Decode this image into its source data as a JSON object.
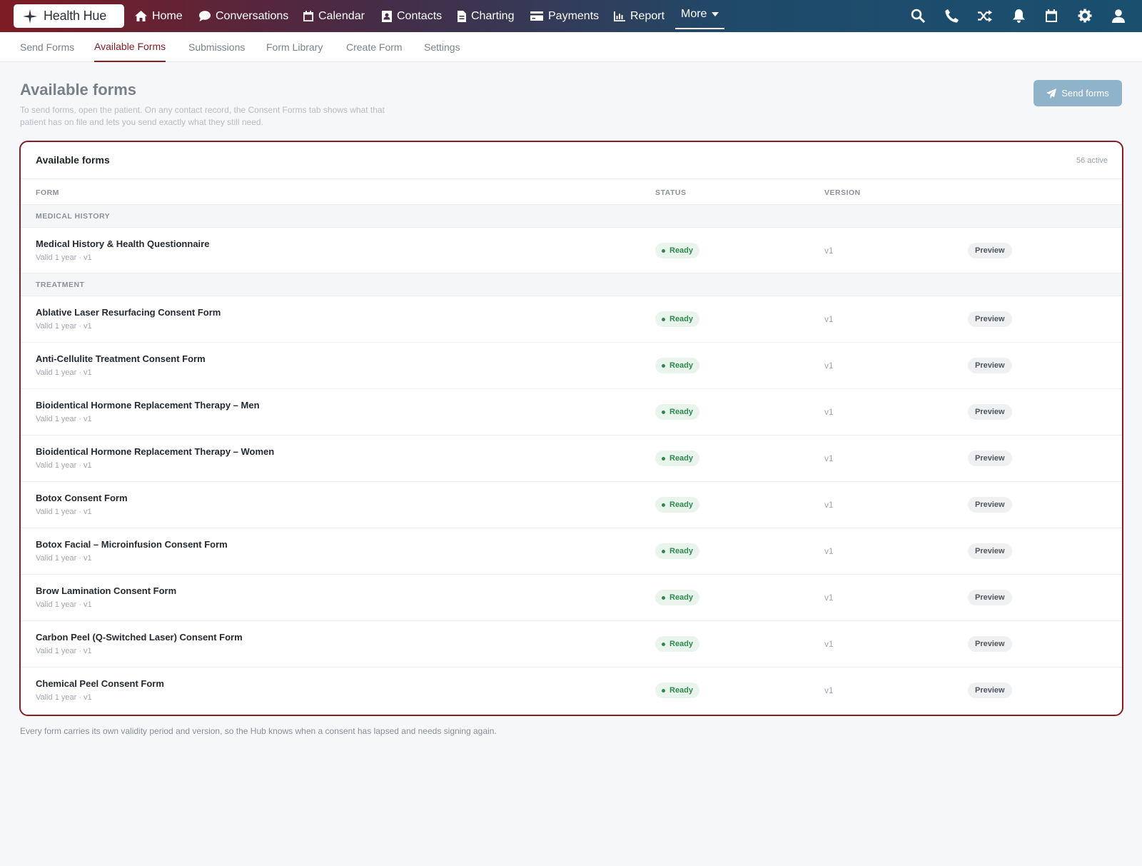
{
  "brand": {
    "name": "Health Hue"
  },
  "nav": {
    "items": [
      {
        "label": "Home",
        "icon": "home-icon"
      },
      {
        "label": "Conversations",
        "icon": "chat-icon"
      },
      {
        "label": "Calendar",
        "icon": "calendar-icon"
      },
      {
        "label": "Contacts",
        "icon": "contacts-icon"
      },
      {
        "label": "Charting",
        "icon": "document-icon"
      },
      {
        "label": "Payments",
        "icon": "credit-card-icon"
      },
      {
        "label": "Report",
        "icon": "chart-icon"
      }
    ],
    "more_label": "More",
    "right_icons": [
      "search-icon",
      "phone-icon",
      "shuffle-icon",
      "bell-icon",
      "calendar-icon",
      "gear-icon",
      "user-icon"
    ]
  },
  "subtabs": [
    "Send Forms",
    "Available Forms",
    "Submissions",
    "Form Library",
    "Create Form",
    "Settings"
  ],
  "active_subtab": "Available Forms",
  "page": {
    "title": "Available forms",
    "description": "To send forms, open the patient. On any contact record, the Consent Forms tab shows what that patient has on file and lets you send exactly what they still need.",
    "send_button": "Send forms"
  },
  "card": {
    "title": "Available forms",
    "count": "56 active",
    "columns": {
      "form": "FORM",
      "status": "STATUS",
      "version": "VERSION"
    }
  },
  "groups": [
    {
      "label": "MEDICAL HISTORY",
      "forms": [
        {
          "name": "Medical History & Health Questionnaire",
          "meta": "Valid 1 year · v1",
          "status": "Ready",
          "version": "v1",
          "action": "Preview"
        }
      ]
    },
    {
      "label": "TREATMENT",
      "forms": [
        {
          "name": "Ablative Laser Resurfacing Consent Form",
          "meta": "Valid 1 year · v1",
          "status": "Ready",
          "version": "v1",
          "action": "Preview"
        },
        {
          "name": "Anti-Cellulite Treatment Consent Form",
          "meta": "Valid 1 year · v1",
          "status": "Ready",
          "version": "v1",
          "action": "Preview"
        },
        {
          "name": "Bioidentical Hormone Replacement Therapy – Men",
          "meta": "Valid 1 year · v1",
          "status": "Ready",
          "version": "v1",
          "action": "Preview"
        },
        {
          "name": "Bioidentical Hormone Replacement Therapy – Women",
          "meta": "Valid 1 year · v1",
          "status": "Ready",
          "version": "v1",
          "action": "Preview"
        },
        {
          "name": "Botox Consent Form",
          "meta": "Valid 1 year · v1",
          "status": "Ready",
          "version": "v1",
          "action": "Preview"
        },
        {
          "name": "Botox Facial – Microinfusion Consent Form",
          "meta": "Valid 1 year · v1",
          "status": "Ready",
          "version": "v1",
          "action": "Preview"
        },
        {
          "name": "Brow Lamination Consent Form",
          "meta": "Valid 1 year · v1",
          "status": "Ready",
          "version": "v1",
          "action": "Preview"
        },
        {
          "name": "Carbon Peel (Q-Switched Laser) Consent Form",
          "meta": "Valid 1 year · v1",
          "status": "Ready",
          "version": "v1",
          "action": "Preview"
        },
        {
          "name": "Chemical Peel Consent Form",
          "meta": "Valid 1 year · v1",
          "status": "Ready",
          "version": "v1",
          "action": "Preview"
        }
      ]
    }
  ],
  "footnote": "Every form carries its own validity period and version, so the Hub knows when a consent has lapsed and needs signing again.",
  "colors": {
    "brand": "#8a1c24",
    "nav_start": "#7e1c24",
    "nav_end": "#1a4f6e",
    "ready": "#2d8a4e",
    "send_button": "#8fb3c9"
  }
}
